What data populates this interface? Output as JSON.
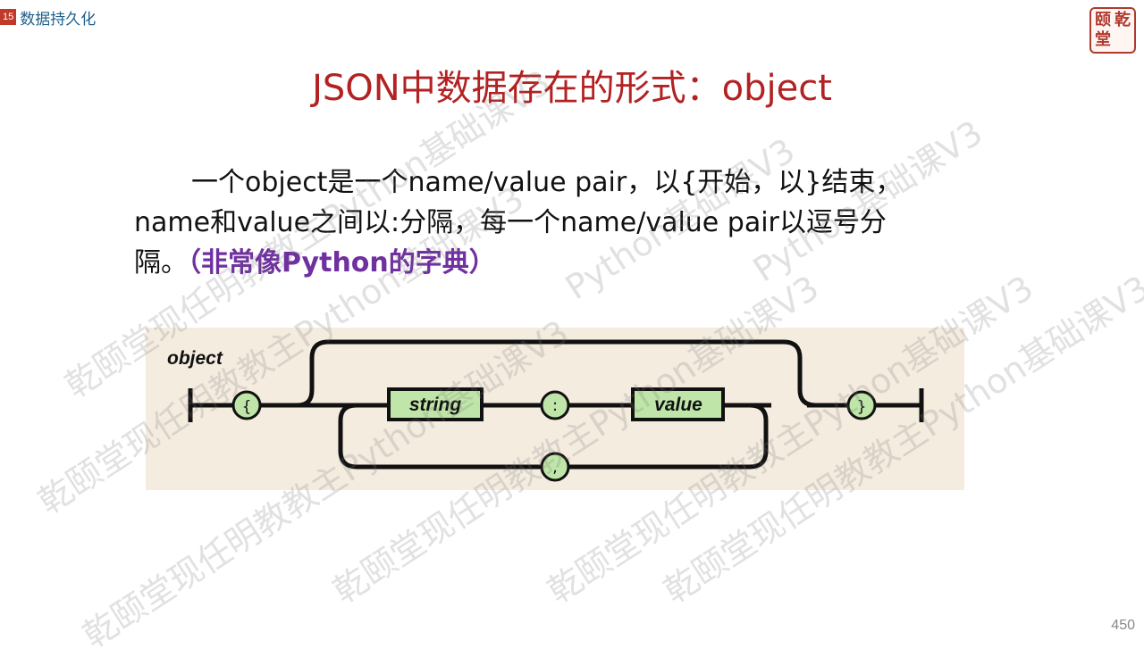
{
  "header": {
    "chapter_number": "15",
    "chapter_title": "数据持久化"
  },
  "logo": {
    "chars": [
      "颐",
      "乾",
      "堂",
      ""
    ]
  },
  "slide": {
    "title": "JSON中数据存在的形式：object",
    "paragraph_main": "一个object是一个name/value pair，以{开始，以}结束，name和value之间以:分隔，每一个name/value pair以逗号分隔。",
    "paragraph_highlight": "（非常像Python的字典）"
  },
  "diagram": {
    "label": "object",
    "open_brace": "{",
    "close_brace": "}",
    "string_box": "string",
    "colon": ":",
    "value_box": "value",
    "comma": ","
  },
  "watermark": {
    "text_a": "乾颐堂现任明教教主Python基础课V3",
    "text_b": "Python基础课V3"
  },
  "footer": {
    "page_number": "450"
  },
  "colors": {
    "title": "#b22222",
    "highlight": "#7030a0",
    "box_fill": "#bfe6a8",
    "diagram_bg": "#f5ece0"
  }
}
